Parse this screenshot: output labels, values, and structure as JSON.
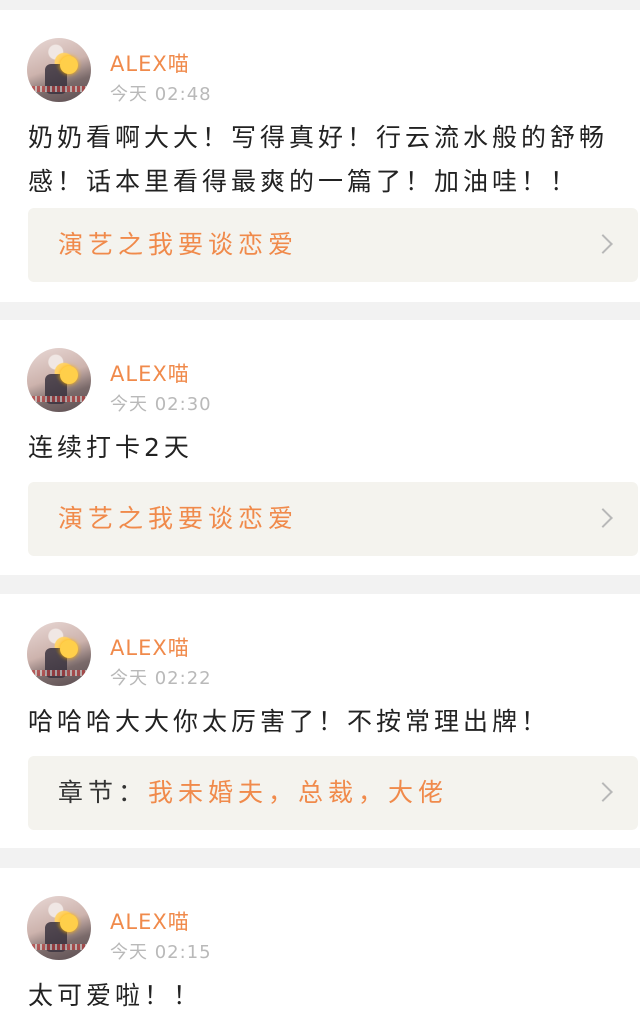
{
  "posts": [
    {
      "username": "ALEX喵",
      "time": "今天 02:48",
      "content": "奶奶看啊大大！写得真好！行云流水般的舒畅感！话本里看得最爽的一篇了！加油哇！！",
      "link_prefix": "",
      "link_text": "演艺之我要谈恋爱"
    },
    {
      "username": "ALEX喵",
      "time": "今天 02:30",
      "content": "连续打卡2天",
      "link_prefix": "",
      "link_text": "演艺之我要谈恋爱"
    },
    {
      "username": "ALEX喵",
      "time": "今天 02:22",
      "content": "哈哈哈大大你太厉害了！不按常理出牌！",
      "link_prefix": "章节：",
      "link_text": "我未婚夫，总裁，大佬"
    },
    {
      "username": "ALEX喵",
      "time": "今天 02:15",
      "content": "太可爱啦！！"
    }
  ],
  "icons": {
    "chevron": "chevron-right-icon"
  },
  "colors": {
    "accent": "#f08a4b",
    "background": "#f2f2f2",
    "link_bg": "#f4f3ee"
  }
}
